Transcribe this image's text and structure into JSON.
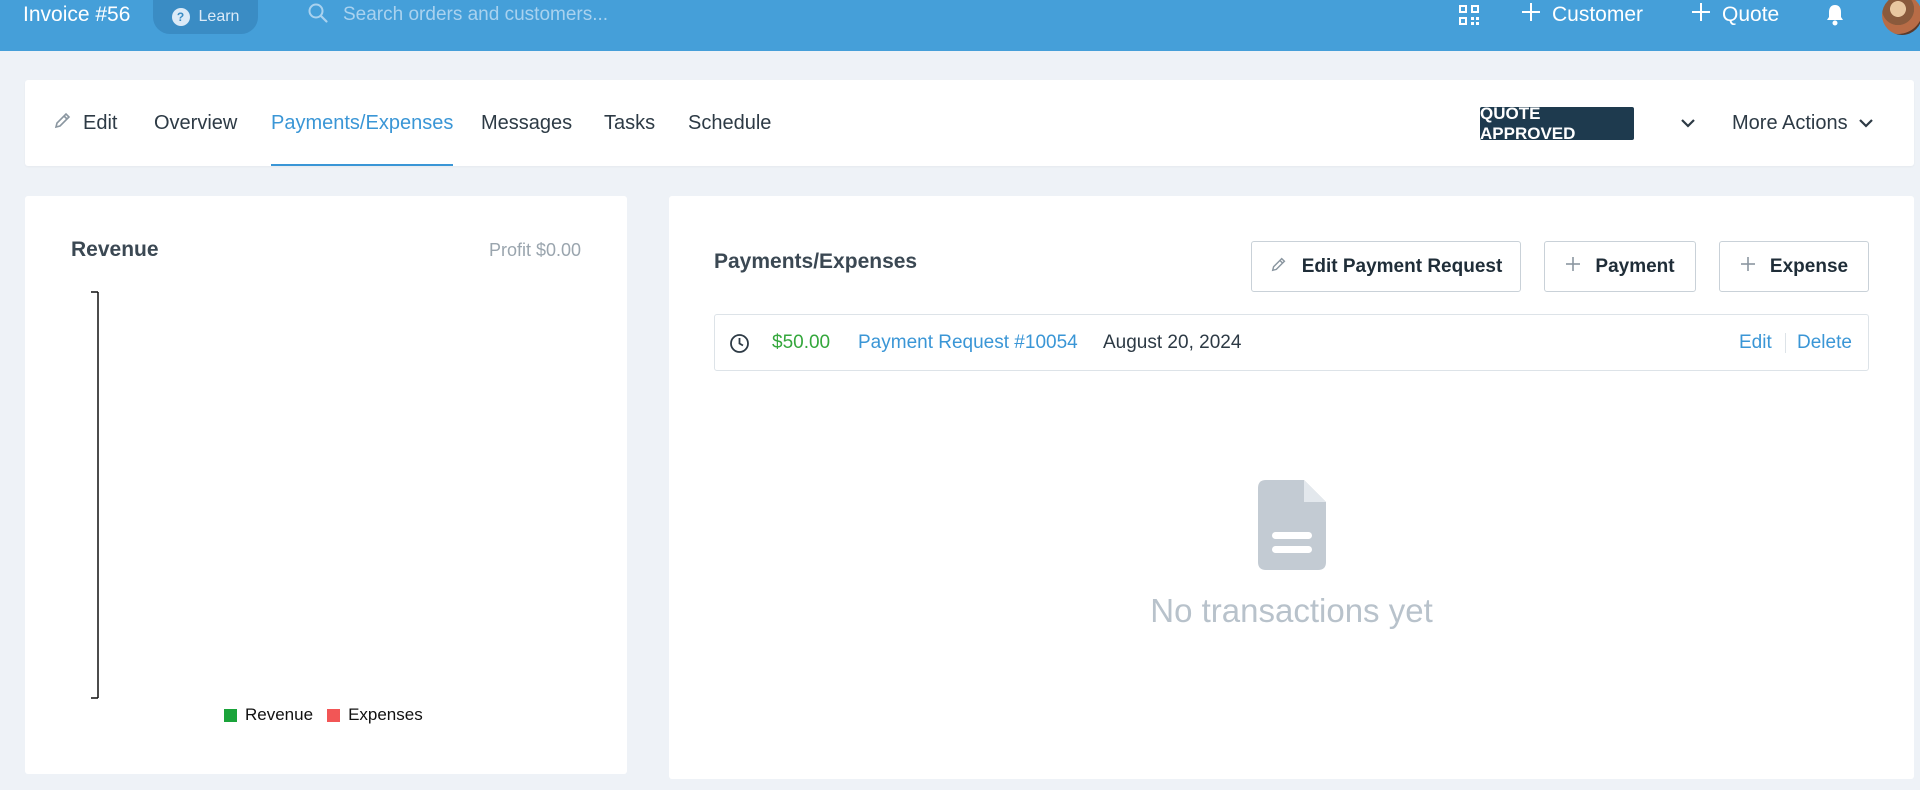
{
  "topbar": {
    "title": "Invoice #56",
    "learn_label": "Learn",
    "search_placeholder": "Search orders and customers...",
    "customer_label": "Customer",
    "quote_label": "Quote"
  },
  "tabs": {
    "edit": "Edit",
    "overview": "Overview",
    "payments": "Payments/Expenses",
    "messages": "Messages",
    "tasks": "Tasks",
    "schedule": "Schedule",
    "active": "Payments/Expenses"
  },
  "status": {
    "badge": "QUOTE APPROVED",
    "more_actions": "More Actions"
  },
  "revenue": {
    "title": "Revenue",
    "profit": "Profit $0.00"
  },
  "chart_data": {
    "type": "bar",
    "categories": [],
    "series": [
      {
        "name": "Revenue",
        "values": [],
        "color": "#1aa33a"
      },
      {
        "name": "Expenses",
        "values": [],
        "color": "#f25656"
      }
    ],
    "legend_position": "bottom",
    "grid": false
  },
  "payments": {
    "title": "Payments/Expenses",
    "edit_request_label": "Edit Payment Request",
    "payment_label": "Payment",
    "expense_label": "Expense",
    "rows": [
      {
        "amount": "$50.00",
        "link": "Payment Request #10054",
        "date": "August 20, 2024",
        "edit": "Edit",
        "delete": "Delete"
      }
    ],
    "empty_text": "No transactions yet"
  },
  "colors": {
    "topbar": "#459fd9",
    "accent": "#3a96d6",
    "badge": "#1e3a4e",
    "amount_green": "#34a73c"
  },
  "icons": [
    "help-icon",
    "search-icon",
    "qr-code-icon",
    "plus-icon",
    "bell-icon",
    "pencil-icon",
    "chevron-down-icon",
    "clock-icon",
    "document-icon"
  ]
}
